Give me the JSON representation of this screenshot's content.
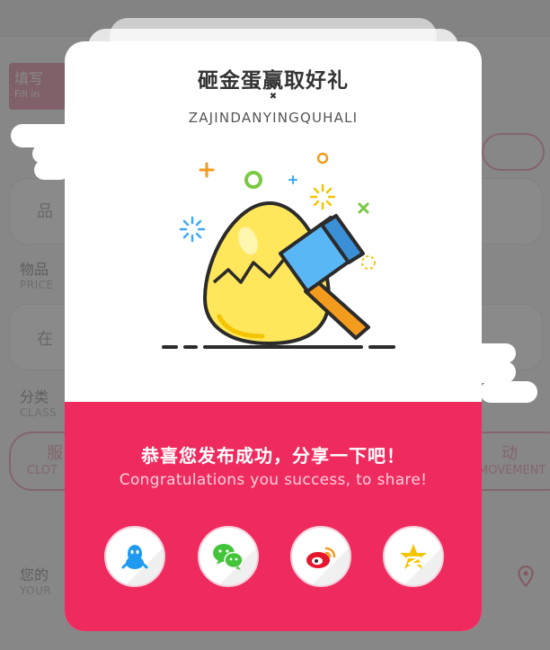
{
  "background": {
    "tag": {
      "cn": "填写",
      "en": "Fill in"
    },
    "labels": [
      {
        "cn": "物品",
        "en": "PRICE"
      },
      {
        "cn": "分类",
        "en": "CLASS"
      },
      {
        "cn": "您的",
        "en": "YOUR"
      }
    ],
    "field_placeholders": [
      "品",
      "在"
    ],
    "pill_left": {
      "cn": "服",
      "en": "CLOT"
    },
    "pill_right": {
      "cn": "动",
      "en": "MOVEMENT"
    }
  },
  "modal": {
    "title": "砸金蛋赢取好礼",
    "title_mark": "✖",
    "subtitle": "ZAJINDANYINGQUHALI",
    "congrats_cn": "恭喜您发布成功，分享一下吧！",
    "congrats_en": "Congratulations you success, to share!",
    "share_buttons": [
      {
        "icon": "qq-icon",
        "color": "#1e9bf0"
      },
      {
        "icon": "wechat-icon",
        "color": "#44c43a"
      },
      {
        "icon": "weibo-icon",
        "color": "#e6162d"
      },
      {
        "icon": "qzone-icon",
        "color": "#f5c400"
      }
    ]
  },
  "colors": {
    "accent": "#ef2a5e",
    "egg": "#ffe65a",
    "hammer": "#5ab7f5"
  }
}
